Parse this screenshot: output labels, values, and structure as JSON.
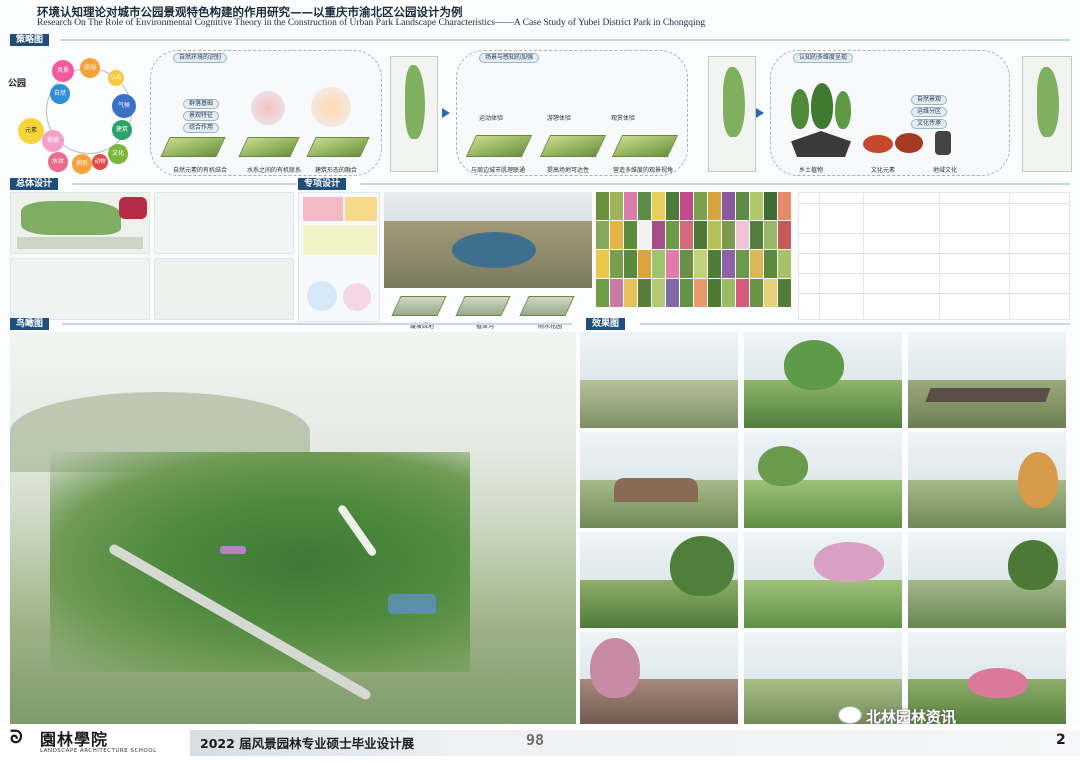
{
  "header": {
    "title_cn": "环境认知理论对城市公园景观特色构建的作用研究——以重庆市渝北区公园设计为例",
    "title_en": "Research On The Role of Environmental Cognitive Theory in the Construction of Urban Park Landscape Characteristics——A Case Study of Yubei District Park in Chongqing"
  },
  "sections": {
    "strategy": "策略图",
    "overall": "总体设计",
    "special": "专项设计",
    "aerial": "鸟瞰图",
    "renderings": "效果图"
  },
  "strategy": {
    "park_label": "公园",
    "wheel_words": [
      "风景",
      "运动",
      "小品",
      "自然",
      "气候",
      "建筑",
      "文化",
      "元素",
      "植被",
      "水体",
      "地形",
      "动物"
    ],
    "panel1_title": "自然环境的识别",
    "panel1_items": [
      "群落基础",
      "景观特征",
      "综合作用"
    ],
    "panel1_caption": "自然元素的有机结合",
    "panel1_caption2": "水系之间的有机联系",
    "panel1_caption3": "建筑形态的融合",
    "panel2_title": "场景与感知的加强",
    "panel2_captions": [
      "运动体验",
      "游憩体验",
      "观赏体验"
    ],
    "panel2_bottom": [
      "与周边城市肌理联通",
      "提高场地可达性",
      "营造多维度的观景视角"
    ],
    "panel3_title": "认知的多维度呈现",
    "panel3_items": [
      "自然景观",
      "运维分区",
      "文化传承"
    ],
    "panel3_captions": [
      "乡土植物",
      "文化元素",
      "地域文化"
    ]
  },
  "special_captions": [
    "缓坡绿地",
    "植草沟",
    "雨水花园"
  ],
  "footer": {
    "logo_name": "園林學院",
    "logo_en": "LANDSCAPE ARCHITECTURE SCHOOL",
    "title": "2022 届风景园林专业硕士毕业设计展",
    "number": "98",
    "page": "2"
  },
  "watermark": "北林园林资讯"
}
